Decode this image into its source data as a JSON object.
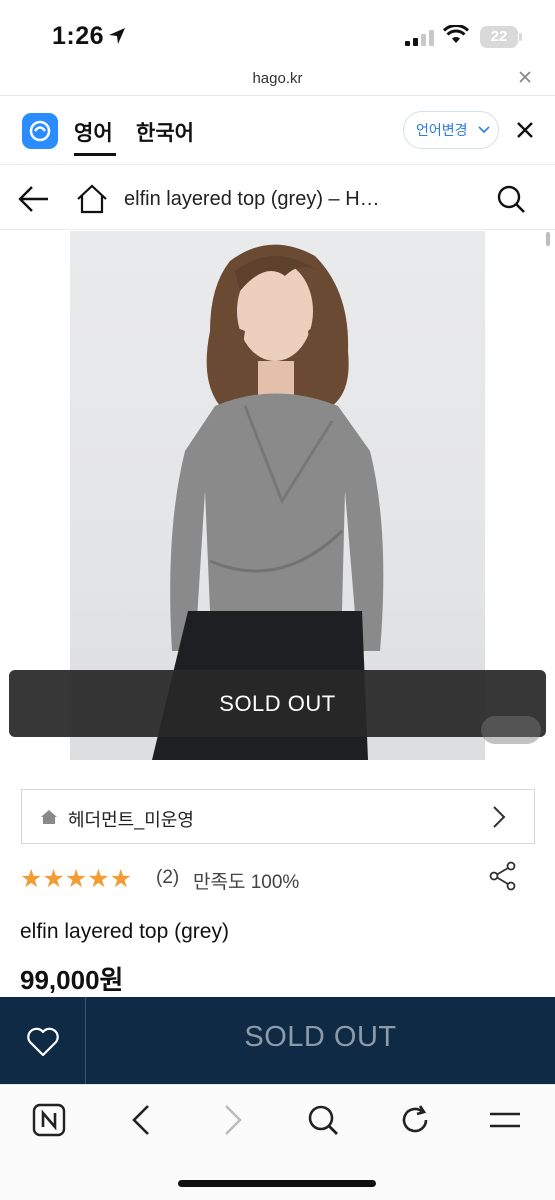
{
  "status_bar": {
    "time": "1:26",
    "battery": "22"
  },
  "url_bar": {
    "url": "hago.kr"
  },
  "translate_bar": {
    "tab_english": "영어",
    "tab_korean": "한국어",
    "change_language": "언어변경"
  },
  "page_header": {
    "title": "elfin layered top (grey) – H…"
  },
  "product": {
    "image_overlay": "SOLD OUT",
    "shop_name": "헤더먼트_미운영",
    "stars": "★★★★★",
    "review_count": "(2)",
    "satisfaction": "만족도 100%",
    "name": "elfin layered top (grey)",
    "price": "99,000원"
  },
  "purchase_bar": {
    "sold_out_label": "SOLD OUT"
  },
  "colors": {
    "accent_blue": "#2a8cff",
    "star_orange": "#f39c35",
    "buy_bar_navy": "#0f2a45"
  },
  "icons": [
    "location-arrow-icon",
    "signal-icon",
    "wifi-icon",
    "battery-icon",
    "close-icon",
    "translate-logo-icon",
    "chevron-down-icon",
    "back-arrow-icon",
    "home-icon",
    "search-icon",
    "shop-home-icon",
    "chevron-right-icon",
    "share-icon",
    "heart-icon",
    "naver-icon",
    "forward-arrow-icon",
    "reload-icon",
    "menu-icon"
  ]
}
